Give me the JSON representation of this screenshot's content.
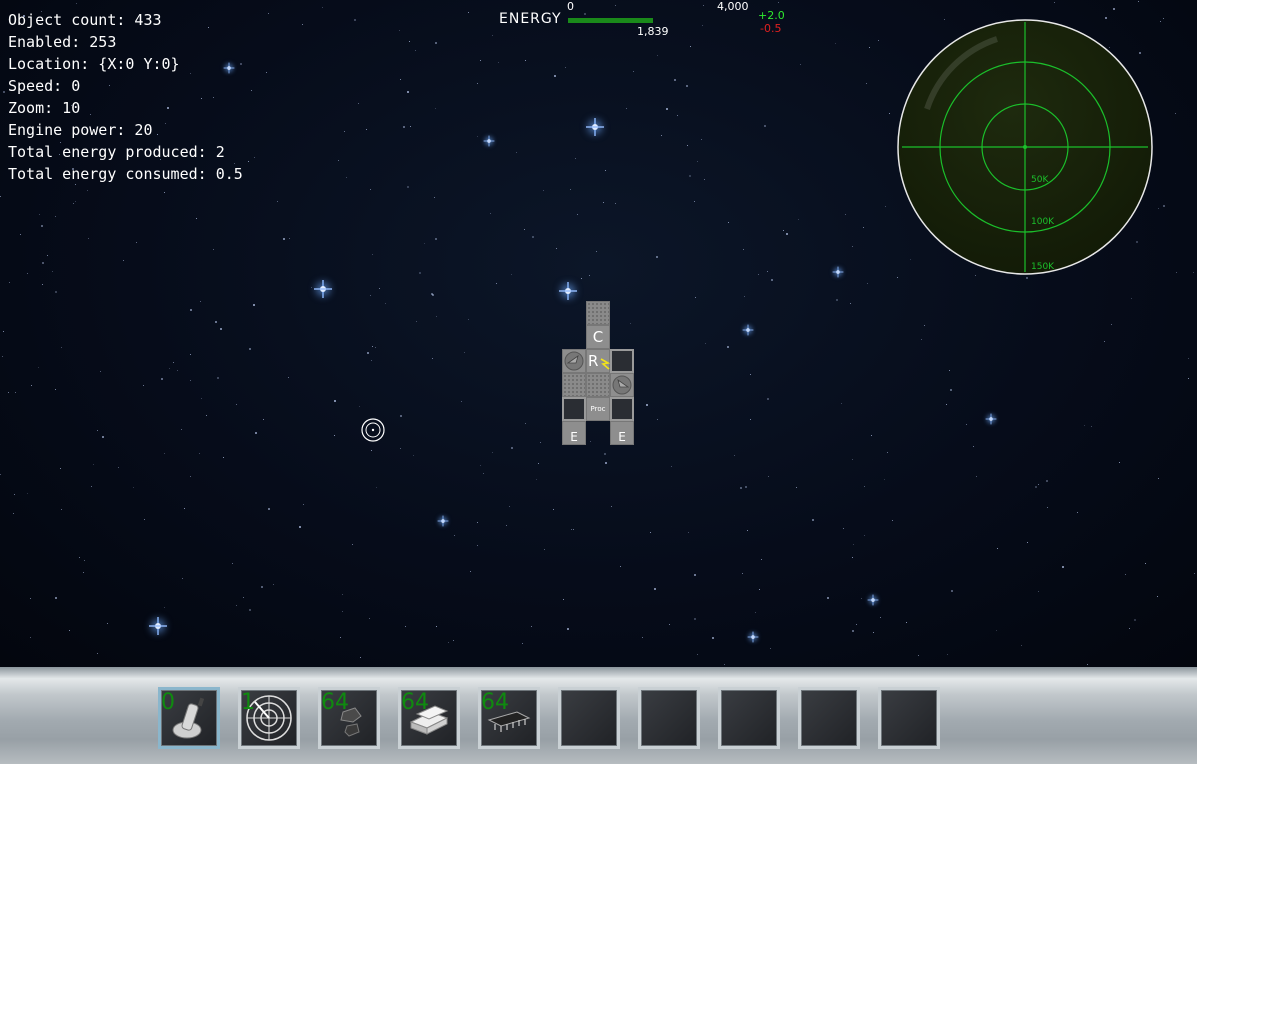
{
  "stats": {
    "object_count": "Object count: 433",
    "enabled": "Enabled: 253",
    "location": "Location: {X:0 Y:0}",
    "speed": "Speed: 0",
    "zoom": "Zoom: 10",
    "engine_power": "Engine power: 20",
    "total_produced": "Total energy produced: 2",
    "total_consumed": "Total energy consumed: 0.5"
  },
  "energy": {
    "label": "ENERGY",
    "min_label": "0",
    "max_label": "4,000",
    "current_label": "1,839",
    "current_value": 1839,
    "max_value": 4000,
    "production": "+2.0",
    "consumption": "-0.5",
    "bar_color": "#1a8a1a",
    "production_color": "#2ee82e",
    "consumption_color": "#e02020"
  },
  "radar": {
    "ring_labels": [
      "50K",
      "100K",
      "150K"
    ],
    "color": "#1bbf2b"
  },
  "ship": {
    "c_label": "C",
    "r_label": "R",
    "proc_label": "Proc",
    "engine_label": "E"
  },
  "toolbar": {
    "slots": [
      {
        "count": "0",
        "icon": "cannon-icon"
      },
      {
        "count": "1",
        "icon": "radar-icon"
      },
      {
        "count": "64",
        "icon": "ore-icon"
      },
      {
        "count": "64",
        "icon": "metal-bars-icon"
      },
      {
        "count": "64",
        "icon": "chip-icon"
      },
      {
        "count": "",
        "icon": ""
      },
      {
        "count": "",
        "icon": ""
      },
      {
        "count": "",
        "icon": ""
      },
      {
        "count": "",
        "icon": ""
      },
      {
        "count": "",
        "icon": ""
      }
    ],
    "selected_index": 0
  }
}
